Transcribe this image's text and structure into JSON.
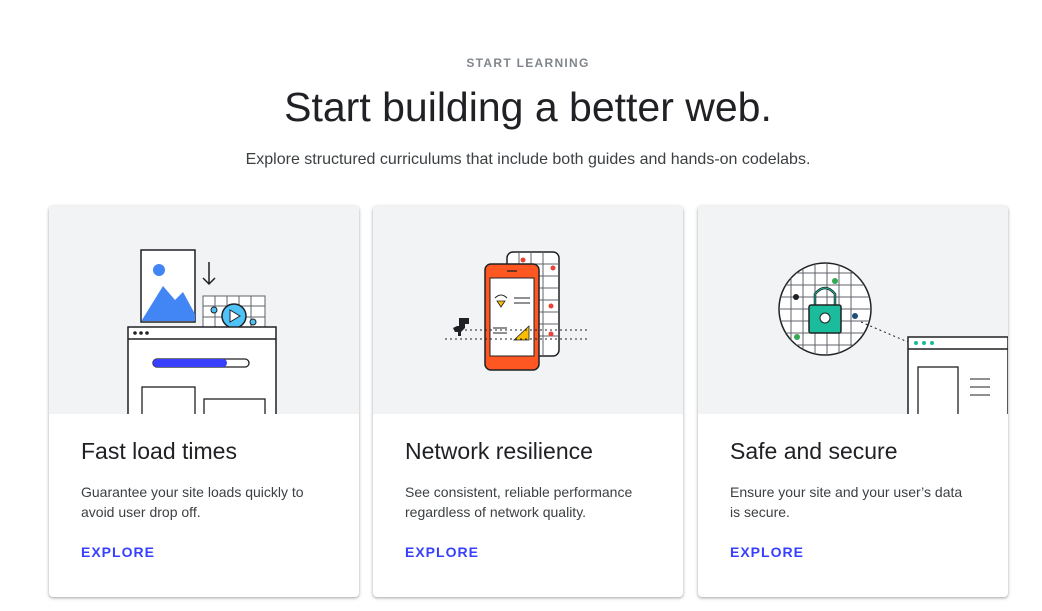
{
  "hero": {
    "eyebrow": "START LEARNING",
    "title": "Start building a better web.",
    "subtitle": "Explore structured curriculums that include both guides and hands-on codelabs."
  },
  "cards": [
    {
      "title": "Fast load times",
      "description": "Guarantee your site loads quickly to avoid user drop off.",
      "link": "EXPLORE",
      "illustration": "image-and-video-loading-browser-illustration"
    },
    {
      "title": "Network resilience",
      "description": "See consistent, reliable performance regardless of network quality.",
      "link": "EXPLORE",
      "illustration": "phone-offline-dino-illustration"
    },
    {
      "title": "Safe and secure",
      "description": "Ensure your site and your user’s data is secure.",
      "link": "EXPLORE",
      "illustration": "padlock-browser-illustration"
    }
  ],
  "colors": {
    "accent_link": "#3740ff",
    "illustration_bg": "#f1f3f4",
    "phone_orange": "#ff5722",
    "lock_teal": "#1abc9c",
    "image_blue": "#4285f4",
    "progress_blue": "#3740ff"
  }
}
